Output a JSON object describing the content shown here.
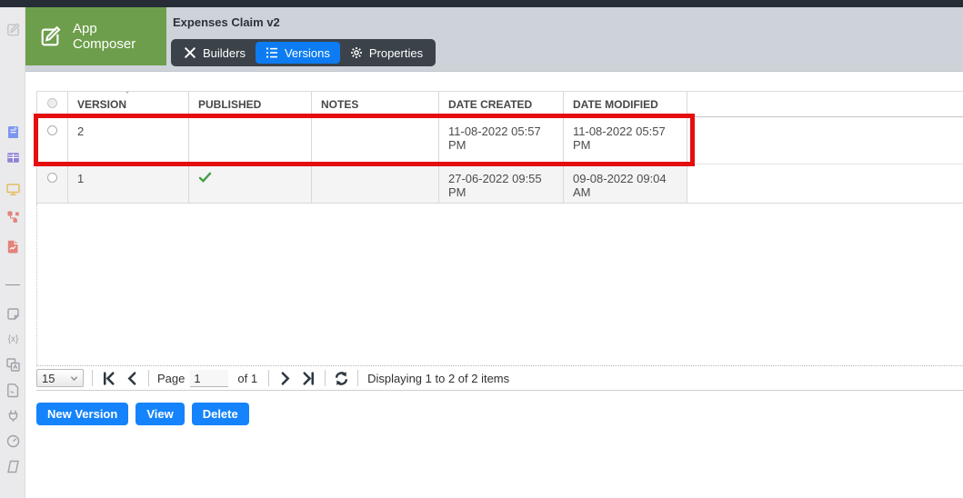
{
  "window": {
    "title": "Expenses Claim v2"
  },
  "logo": {
    "line1": "App",
    "line2": "Composer"
  },
  "tabs": {
    "builders": "Builders",
    "versions": "Versions",
    "properties": "Properties",
    "active_tab": "Versions"
  },
  "sidebar_icons": [
    "compose-icon",
    "form-icon",
    "datalist-icon",
    "userview-icon",
    "process-icon",
    "report-icon",
    "note-icon",
    "variables-icon",
    "localization-icon",
    "log-icon",
    "plugin-icon",
    "performance-icon",
    "copy-icon"
  ],
  "table": {
    "headers": {
      "version": "VERSION",
      "published": "PUBLISHED",
      "notes": "NOTES",
      "date_created": "DATE CREATED",
      "date_modified": "DATE MODIFIED"
    },
    "sort_column": "VERSION",
    "rows": [
      {
        "version": "2",
        "published": "",
        "notes": "",
        "date_created": "11-08-2022 05:57 PM",
        "date_modified": "11-08-2022 05:57 PM",
        "highlighted": true
      },
      {
        "version": "1",
        "published": "check-icon",
        "notes": "",
        "date_created": "27-06-2022 09:55 PM",
        "date_modified": "09-08-2022 09:04 AM",
        "highlighted": false
      }
    ]
  },
  "pager": {
    "page_size": "15",
    "page_label": "Page",
    "page_value": "1",
    "of_label": "of 1",
    "status": "Displaying 1 to 2 of 2 items",
    "icons": [
      "first-page-icon",
      "prev-page-icon",
      "next-page-icon",
      "last-page-icon",
      "refresh-icon"
    ]
  },
  "buttons": {
    "new_version": "New Version",
    "view": "View",
    "delete": "Delete"
  },
  "colors": {
    "accent_blue": "#0d7cf2",
    "button_blue": "#1583fb",
    "logo_green": "#6d9e4b",
    "annotation_red": "#e50e0e",
    "check_green": "#43a047",
    "topbar_dark": "#272d37",
    "header_gray": "#ced3d9",
    "tabbar_dark": "#3b424a"
  }
}
